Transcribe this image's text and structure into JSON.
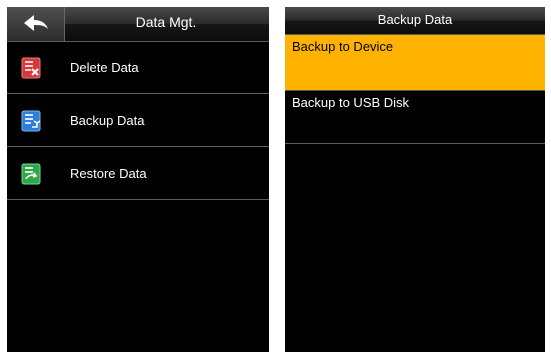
{
  "left_screen": {
    "title": "Data Mgt.",
    "items": [
      {
        "label": "Delete Data",
        "icon": "delete-data-icon"
      },
      {
        "label": "Backup Data",
        "icon": "backup-data-icon"
      },
      {
        "label": "Restore Data",
        "icon": "restore-data-icon"
      }
    ]
  },
  "right_screen": {
    "title": "Backup Data",
    "options": [
      {
        "label": "Backup to Device",
        "selected": true
      },
      {
        "label": "Backup to USB Disk",
        "selected": false
      }
    ]
  },
  "colors": {
    "screen_bg": "#000000",
    "selected_bg": "#ffb300",
    "divider": "#5c5c5c"
  }
}
